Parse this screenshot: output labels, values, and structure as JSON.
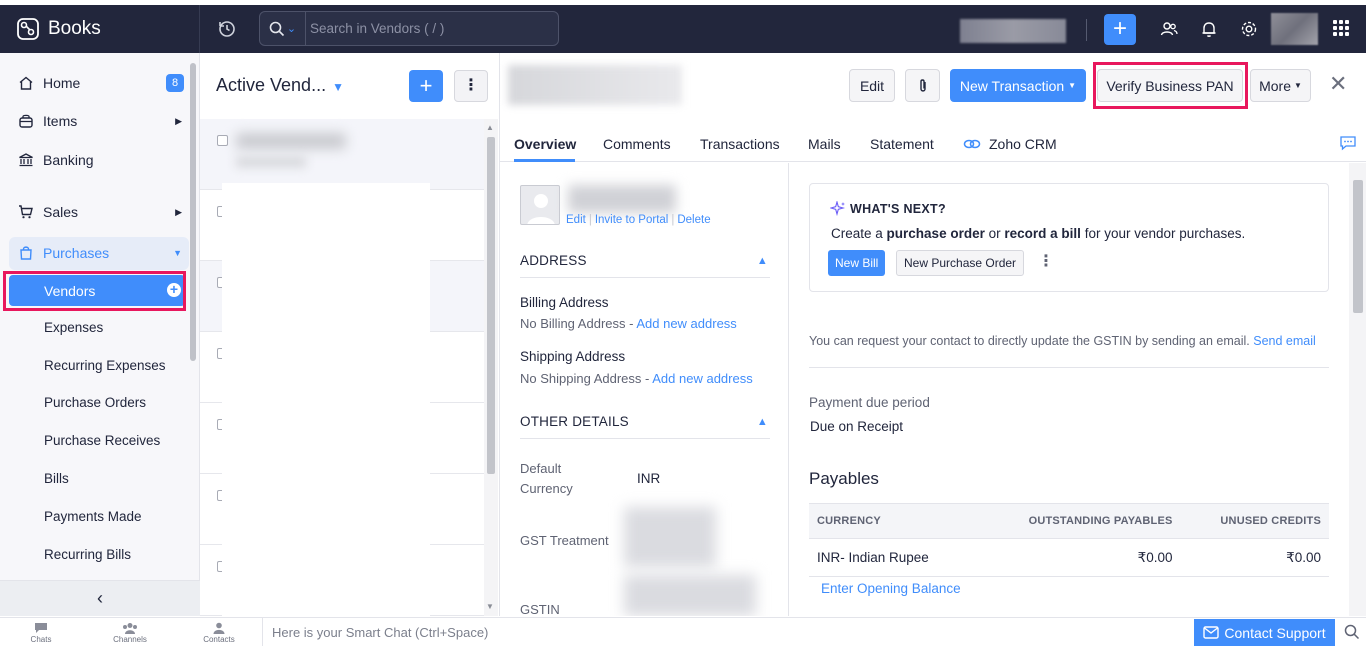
{
  "app": {
    "name": "Books"
  },
  "search": {
    "placeholder": "Search in Vendors ( / )"
  },
  "sidebar": {
    "home": "Home",
    "home_badge": "8",
    "items": "Items",
    "banking": "Banking",
    "sales": "Sales",
    "purchases": "Purchases",
    "sub": [
      "Vendors",
      "Expenses",
      "Recurring Expenses",
      "Purchase Orders",
      "Purchase Receives",
      "Bills",
      "Payments Made",
      "Recurring Bills"
    ]
  },
  "list": {
    "title": "Active Vend..."
  },
  "detail": {
    "edit": "Edit",
    "new_transaction": "New Transaction",
    "verify_pan": "Verify Business PAN",
    "more": "More",
    "tabs": [
      "Overview",
      "Comments",
      "Transactions",
      "Mails",
      "Statement",
      "Zoho CRM"
    ],
    "contact_links": [
      "Edit",
      "Invite to Portal",
      "Delete"
    ],
    "address_header": "ADDRESS",
    "billing_label": "Billing Address",
    "billing_value": "No Billing Address",
    "shipping_label": "Shipping Address",
    "shipping_value": "No Shipping Address",
    "add_address": "Add new address",
    "other_header": "OTHER DETAILS",
    "currency_label_1": "Default",
    "currency_label_2": "Currency",
    "currency_value": "INR",
    "gst_treatment": "GST Treatment",
    "gstin": "GSTIN"
  },
  "whats_next": {
    "title": "WHAT'S NEXT?",
    "text_1": "Create a",
    "bold_1": "purchase order",
    "text_2": "or",
    "bold_2": "record a bill",
    "text_3": "for your vendor purchases.",
    "new_bill": "New Bill",
    "new_po": "New Purchase Order"
  },
  "gst_note": {
    "text": "You can request your contact to directly update the GSTIN by sending an email.",
    "link": "Send email"
  },
  "payment_due": {
    "label": "Payment due period",
    "value": "Due on Receipt"
  },
  "payables": {
    "title": "Payables",
    "headers": [
      "CURRENCY",
      "OUTSTANDING PAYABLES",
      "UNUSED CREDITS"
    ],
    "rows": [
      {
        "currency": "INR- Indian Rupee",
        "outstanding": "₹0.00",
        "credits": "₹0.00"
      }
    ],
    "opening_balance": "Enter Opening Balance"
  },
  "bottom": {
    "chats": "Chats",
    "channels": "Channels",
    "contacts": "Contacts",
    "smart_chat": "Here is your Smart Chat (Ctrl+Space)",
    "support": "Contact Support"
  },
  "colors": {
    "accent": "#408dfb",
    "topbar": "#22263c",
    "highlight": "#e8175d"
  }
}
